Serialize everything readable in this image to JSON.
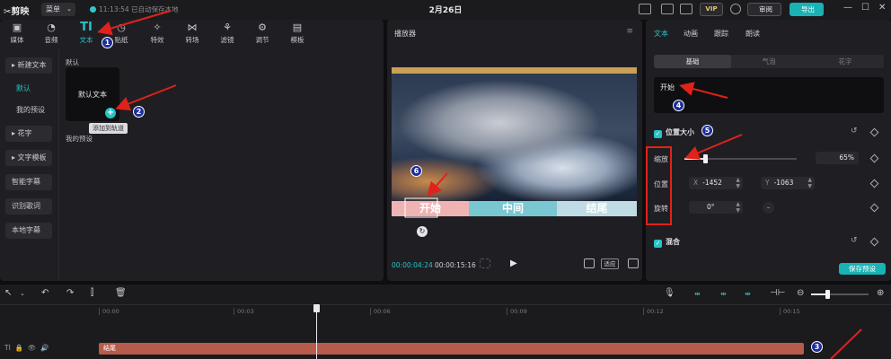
{
  "titlebar": {
    "app_name": "剪映",
    "menu_label": "菜单",
    "autosave": "11:13:54 已自动保存本地",
    "title": "2月26日",
    "vip_label": "VIP",
    "review_label": "审阅",
    "export_label": "导出"
  },
  "toolbar": {
    "tabs": [
      "媒体",
      "音频",
      "文本",
      "贴纸",
      "特效",
      "转场",
      "滤镜",
      "调节",
      "模板"
    ],
    "active_tab": "文本",
    "icons": [
      "media-icon",
      "audio-icon",
      "text-icon",
      "sticker-icon",
      "effects-icon",
      "transition-icon",
      "filter-icon",
      "adjust-icon",
      "template-icon"
    ]
  },
  "sidebar": {
    "items": [
      {
        "label": "▸ 新建文本",
        "type": "group"
      },
      {
        "label": "默认",
        "type": "sub",
        "active": true
      },
      {
        "label": "我的预设",
        "type": "sub"
      },
      {
        "label": "▸ 花字",
        "type": "group"
      },
      {
        "label": "▸ 文字模板",
        "type": "group"
      },
      {
        "label": "智能字幕",
        "type": "group"
      },
      {
        "label": "识别歌词",
        "type": "group"
      },
      {
        "label": "本地字幕",
        "type": "group"
      }
    ]
  },
  "content": {
    "section_default": "默认",
    "card_text": "默认文本",
    "tooltip": "添加到轨道",
    "section_presets": "我的预设"
  },
  "player": {
    "title": "播放器",
    "subtitle_segments": [
      {
        "text": "开始",
        "color": "#f0b3b3"
      },
      {
        "text": "中间",
        "color": "#79c7d0"
      },
      {
        "text": "结尾",
        "color": "#c0dbe4"
      }
    ],
    "current_time": "00:00:04:24",
    "total_time": "00:00:15:16",
    "fit_label": "适应"
  },
  "inspector": {
    "tabs": [
      "文本",
      "动画",
      "跟踪",
      "朗读"
    ],
    "active_tab": "文本",
    "subtabs": [
      "基础",
      "气泡",
      "花字"
    ],
    "active_subtab": "基础",
    "text_value": "开始",
    "position_size_label": "位置大小",
    "scale_label": "缩放",
    "scale_value": "65%",
    "scale_fraction": 0.18,
    "position_label": "位置",
    "x_prefix": "X",
    "x_value": "-1452",
    "y_prefix": "Y",
    "y_value": "-1063",
    "rotate_label": "旋转",
    "rotate_value": "0°",
    "blend_label": "混合",
    "save_preset_label": "保存预设"
  },
  "timeline": {
    "ruler": [
      "00:00",
      "00:03",
      "00:06",
      "00:09",
      "00:12",
      "00:15"
    ],
    "clip_label": "结尾",
    "track_icons": [
      "TI",
      "🔒",
      "👁",
      "🔊"
    ]
  },
  "annotations": {
    "badges": [
      "1",
      "2",
      "3",
      "4",
      "5",
      "6"
    ],
    "color": "#e0221b"
  }
}
